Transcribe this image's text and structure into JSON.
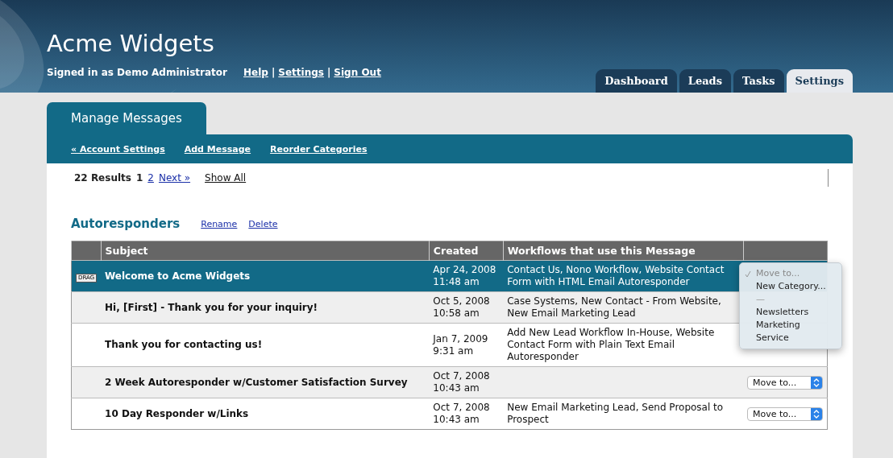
{
  "header": {
    "title": "Acme Widgets",
    "signed_in": "Signed in as Demo Administrator",
    "links": [
      "Help",
      "Settings",
      "Sign Out"
    ],
    "separator": "|"
  },
  "tabs": [
    {
      "label": "Dashboard",
      "selected": false
    },
    {
      "label": "Leads",
      "selected": false
    },
    {
      "label": "Tasks",
      "selected": false
    },
    {
      "label": "Settings",
      "selected": true
    }
  ],
  "panel": {
    "title": "Manage Messages",
    "nav": [
      "« Account Settings",
      "Add Message",
      "Reorder Categories"
    ]
  },
  "pager": {
    "results": "22 Results",
    "current": "1",
    "pages": [
      "2",
      "Next »"
    ],
    "show_all": "Show All"
  },
  "section": {
    "title": "Autoresponders",
    "actions": [
      "Rename",
      "Delete"
    ]
  },
  "table": {
    "columns": [
      "Subject",
      "Created",
      "Workflows that use this Message"
    ],
    "rows": [
      {
        "subject": "Welcome to Acme Widgets",
        "date": "Apr 24, 2008",
        "time": "11:48 am",
        "workflows": "Contact Us, Nono Workflow, Website Contact Form with HTML Email Autoresponder",
        "selected": true,
        "drag": "DRAG"
      },
      {
        "subject": "Hi, [First] - Thank you for your inquiry!",
        "date": "Oct 5, 2008",
        "time": "10:58 am",
        "workflows": "Case Systems, New Contact - From Website, New Email Marketing Lead",
        "selected": false
      },
      {
        "subject": "Thank you for contacting us!",
        "date": "Jan 7, 2009",
        "time": "9:31 am",
        "workflows": "Add New Lead Workflow In-House, Website Contact Form with Plain Text Email Autoresponder",
        "selected": false
      },
      {
        "subject": "2 Week Autoresponder w/Customer Satisfaction Survey",
        "date": "Oct 7, 2008",
        "time": "10:43 am",
        "selected": false,
        "move": "Move to..."
      },
      {
        "subject": "10 Day Responder w/Links",
        "date": "Oct 7, 2008",
        "time": "10:43 am",
        "workflows": "New Email Marketing Lead, Send Proposal to Prospect",
        "selected": false,
        "move": "Move to..."
      }
    ]
  },
  "move_menu": [
    {
      "label": "Move to...",
      "selected": true,
      "kind": "option"
    },
    {
      "label": "New Category...",
      "selected": false,
      "kind": "option"
    },
    {
      "label": "—",
      "selected": false,
      "kind": "separator"
    },
    {
      "label": "Newsletters",
      "selected": false,
      "kind": "option"
    },
    {
      "label": "Marketing",
      "selected": false,
      "kind": "option"
    },
    {
      "label": "Service",
      "selected": false,
      "kind": "option"
    }
  ]
}
